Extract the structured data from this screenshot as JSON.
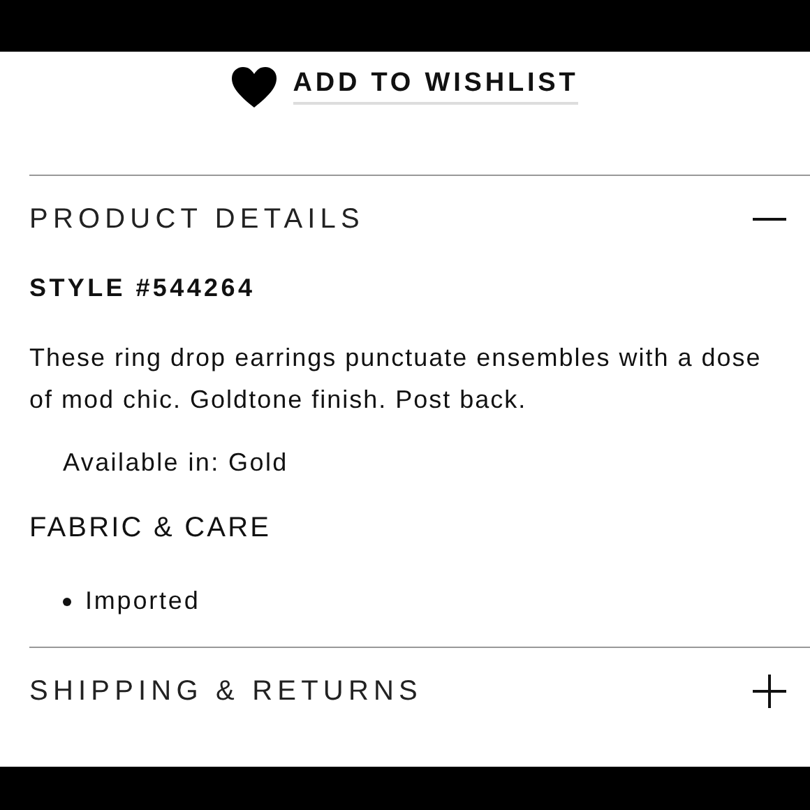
{
  "wishlist": {
    "label": "ADD TO WISHLIST"
  },
  "sections": [
    {
      "title": "PRODUCT DETAILS",
      "expanded": true,
      "style": "STYLE #544264",
      "description": "These ring drop earrings punctuate ensembles with a dose of mod chic. Goldtone finish. Post back.",
      "availability": "Available in: Gold",
      "subheading": "FABRIC & CARE",
      "bullets": [
        "Imported"
      ]
    },
    {
      "title": "SHIPPING & RETURNS",
      "expanded": false
    }
  ]
}
